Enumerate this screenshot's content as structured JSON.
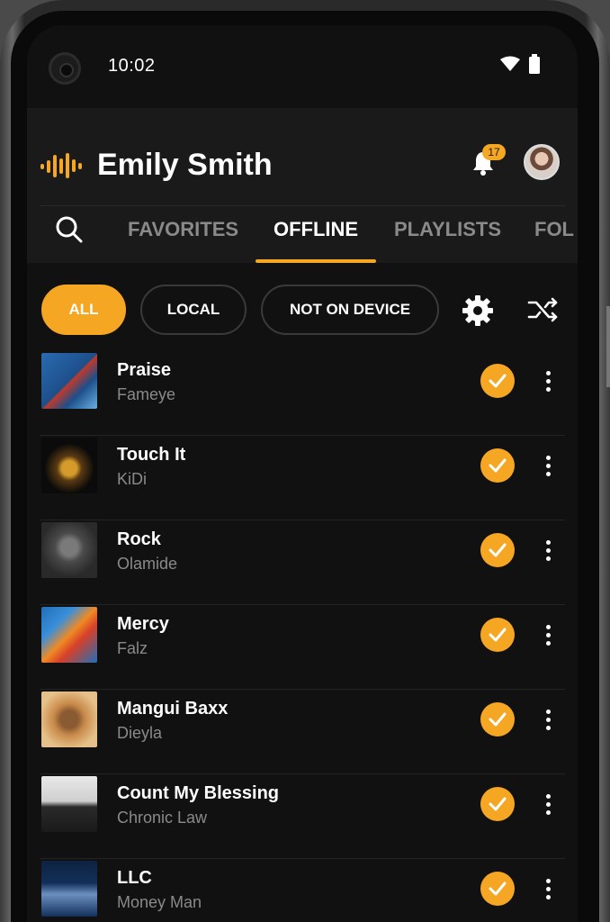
{
  "status_bar": {
    "time": "10:02"
  },
  "header": {
    "username": "Emily Smith",
    "notification_count": "17"
  },
  "tabs": [
    {
      "label": "FAVORITES",
      "active": false
    },
    {
      "label": "OFFLINE",
      "active": true
    },
    {
      "label": "PLAYLISTS",
      "active": false
    },
    {
      "label": "FOL",
      "active": false
    }
  ],
  "filters": [
    {
      "label": "ALL",
      "active": true
    },
    {
      "label": "LOCAL",
      "active": false
    },
    {
      "label": "NOT ON DEVICE",
      "active": false
    }
  ],
  "songs": [
    {
      "title": "Praise",
      "artist": "Fameye",
      "art_colors": [
        "#1d4f8a",
        "#c0392b"
      ]
    },
    {
      "title": "Touch It",
      "artist": "KiDi",
      "art_colors": [
        "#0b0b0b",
        "#d49a2a"
      ]
    },
    {
      "title": "Rock",
      "artist": "Olamide",
      "art_colors": [
        "#3a3a3a",
        "#7a7a7a"
      ]
    },
    {
      "title": "Mercy",
      "artist": "Falz",
      "art_colors": [
        "#1f6fb8",
        "#f08a24"
      ]
    },
    {
      "title": "Mangui Baxx",
      "artist": "Dieyla",
      "art_colors": [
        "#c88a4a",
        "#5a3a22"
      ]
    },
    {
      "title": "Count My Blessing",
      "artist": "Chronic Law",
      "art_colors": [
        "#e8e8e8",
        "#2a2a2a"
      ]
    },
    {
      "title": "LLC",
      "artist": "Money Man",
      "art_colors": [
        "#13305a",
        "#6a8fc0"
      ]
    }
  ],
  "colors": {
    "accent": "#f5a623",
    "background": "#111111",
    "header_bg": "#1a1a1a",
    "muted_text": "#8a8a8a"
  }
}
